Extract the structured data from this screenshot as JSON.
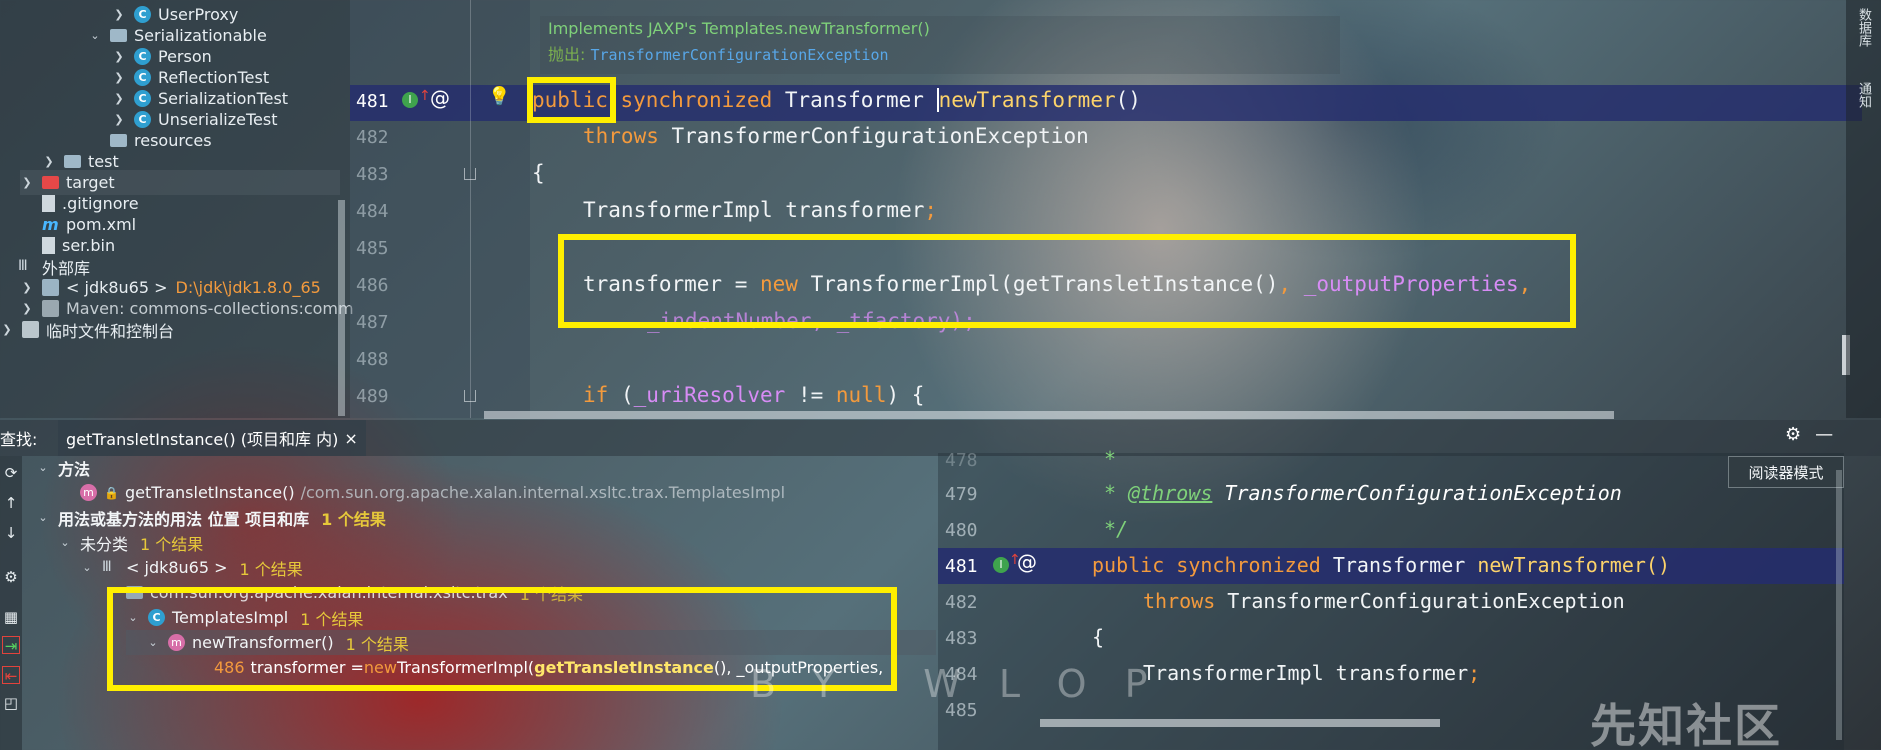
{
  "tree": {
    "items": [
      {
        "label": "UserProxy",
        "icon": "class"
      },
      {
        "label": "Serializationable",
        "icon": "package"
      },
      {
        "label": "Person",
        "icon": "class"
      },
      {
        "label": "ReflectionTest",
        "icon": "class"
      },
      {
        "label": "SerializationTest",
        "icon": "class"
      },
      {
        "label": "UnserializeTest",
        "icon": "class"
      },
      {
        "label": "resources",
        "icon": "folder"
      },
      {
        "label": "test",
        "icon": "folder"
      },
      {
        "label": "target",
        "icon": "folder-red"
      },
      {
        "label": ".gitignore",
        "icon": "file"
      },
      {
        "label": "pom.xml",
        "icon": "maven"
      },
      {
        "label": "ser.bin",
        "icon": "file"
      },
      {
        "label": "外部库",
        "icon": "library"
      },
      {
        "label": "< jdk8u65 >",
        "icon": "jdk",
        "path": "D:\\jdk\\jdk1.8.0_65"
      },
      {
        "label": "Maven: commons-collections:comm",
        "icon": "maven-lib"
      },
      {
        "label": "临时文件和控制台",
        "icon": "scratch"
      }
    ]
  },
  "hint": {
    "line1": "Implements JAXP's Templates.newTransformer()",
    "throws_label": "抛出:",
    "exception": "TransformerConfigurationException"
  },
  "editor": {
    "lines": [
      "481",
      "482",
      "483",
      "484",
      "485",
      "486",
      "487",
      "488",
      "489"
    ],
    "code": {
      "l481_kw1": "public",
      "l481_kw2": " synchronized",
      "l481_type": " Transformer ",
      "l481_fn": "newTransformer",
      "l481_paren": "()",
      "l482_kw": "throws",
      "l482_rest": " TransformerConfigurationException",
      "l483": "{",
      "l484": "TransformerImpl transformer",
      "l484_semi": ";",
      "l486_a": "transformer = ",
      "l486_new": "new",
      "l486_b": " TransformerImpl(getTransletInstance()",
      "l486_sep": ", ",
      "l486_fld": "_outputProperties",
      "l486_comma": ",",
      "l487": "_indentNumber, _tfactory);",
      "l489_kw": "if",
      "l489_a": " (",
      "l489_fld": "_uriResolver",
      "l489_b": " != ",
      "l489_null": "null",
      "l489_c": ") {"
    }
  },
  "rightbar": {
    "db": "数据库",
    "notify": "通知"
  },
  "find": {
    "prefix": "查找:",
    "tab_label": "getTransletInstance() (项目和库 内)",
    "close": "×",
    "methods_header": "方法",
    "method_name": "getTransletInstance()",
    "method_path": "/com.sun.org.apache.xalan.internal.xsltc.trax.TemplatesImpl",
    "usages_header": "用法或基方法的用法 位置 项目和库",
    "usages_count": "1 个结果",
    "uncat": "未分类",
    "uncat_count": "1 个结果",
    "jdk": "< jdk8u65 >",
    "jdk_count": "1 个结果",
    "pkg": "com.sun.org.apache.xalan.internal.xsltc.trax",
    "pkg_count": "1 个结果",
    "cls": "TemplatesImpl",
    "cls_count": "1 个结果",
    "mth": "newTransformer()",
    "mth_count": "1 个结果",
    "usage_line": "486",
    "usage_a": "transformer = ",
    "usage_new": "new",
    "usage_b": " TransformerImpl(",
    "usage_bold": "getTransletInstance",
    "usage_c": "(), _outputProperties,"
  },
  "preview": {
    "lines": [
      "478",
      "479",
      "480",
      "481",
      "482",
      "483",
      "484",
      "485"
    ],
    "c478": "*",
    "c479_star": "* ",
    "c479_tag": "@throws",
    "c479_ex": " TransformerConfigurationException",
    "c480": "*/",
    "c481_kw1": "public",
    "c481_kw2": " synchronized",
    "c481_type": " Transformer ",
    "c481_fn": "newTransformer()",
    "c482_kw": "throws",
    "c482_rest": " TransformerConfigurationException",
    "c483": "{",
    "c484": "TransformerImpl transformer",
    "c484_semi": ";",
    "reader_mode": "阅读器模式"
  },
  "overlay": {
    "watermark": "先知社区",
    "art_text": "BY WLOP"
  },
  "colors": {
    "keyword": "#f39a3d",
    "function": "#fcd36a",
    "field": "#d78cf5",
    "highlight_box": "#ffef00",
    "count": "#e6c83a"
  }
}
